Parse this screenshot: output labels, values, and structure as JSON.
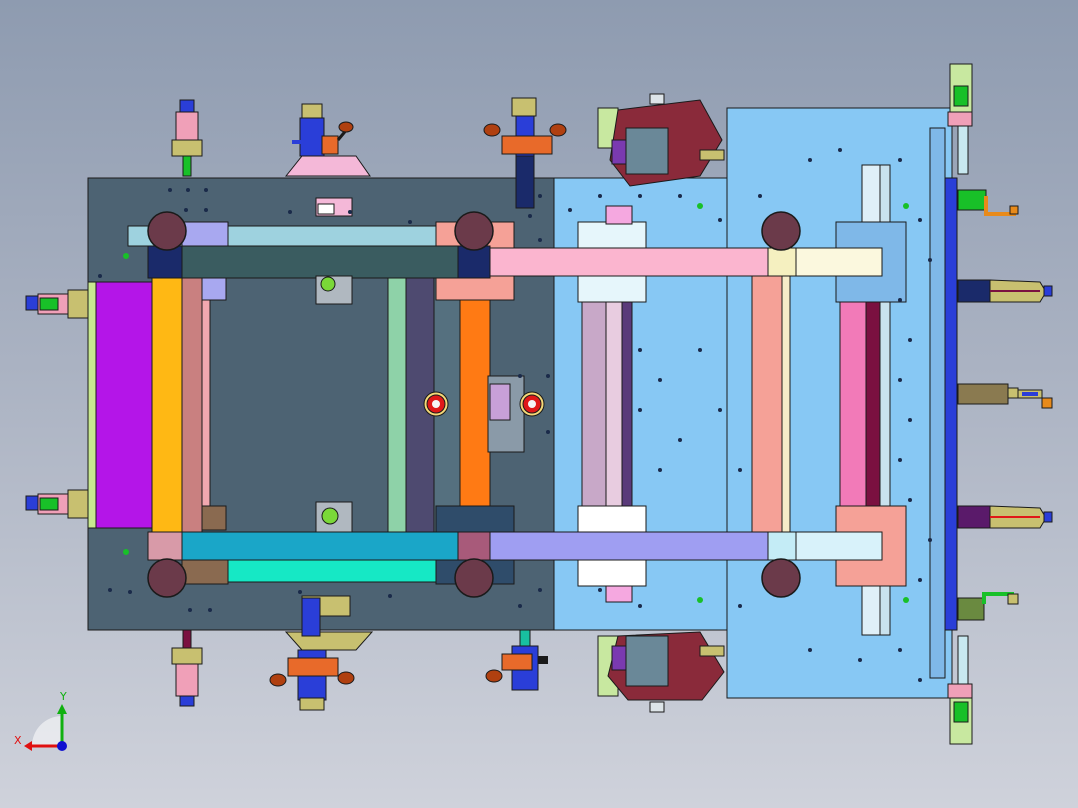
{
  "view": {
    "background_top": "#8e9bb0",
    "background_bottom": "#cfd2db",
    "line_color": "#1a1a1a"
  },
  "triad": {
    "x_label": "X",
    "y_label": "Y",
    "x_color": "#e01010",
    "y_color": "#10b010",
    "z_color": "#1010d0"
  },
  "colors": {
    "left_plate": "#4d6373",
    "right_plate": "#87c8f4",
    "magenta": "#b415e8",
    "orange": "#ff7a14",
    "yellow": "#ffb814",
    "pink_bar": "#fbb5cf",
    "teal_bar": "#16e8c5",
    "lavender_bar": "#9f9ef2",
    "hot_pink": "#f27ab8",
    "salmon": "#f5a197",
    "wheel": "#6b3a4a",
    "blue_rail": "#2a3ed8"
  }
}
